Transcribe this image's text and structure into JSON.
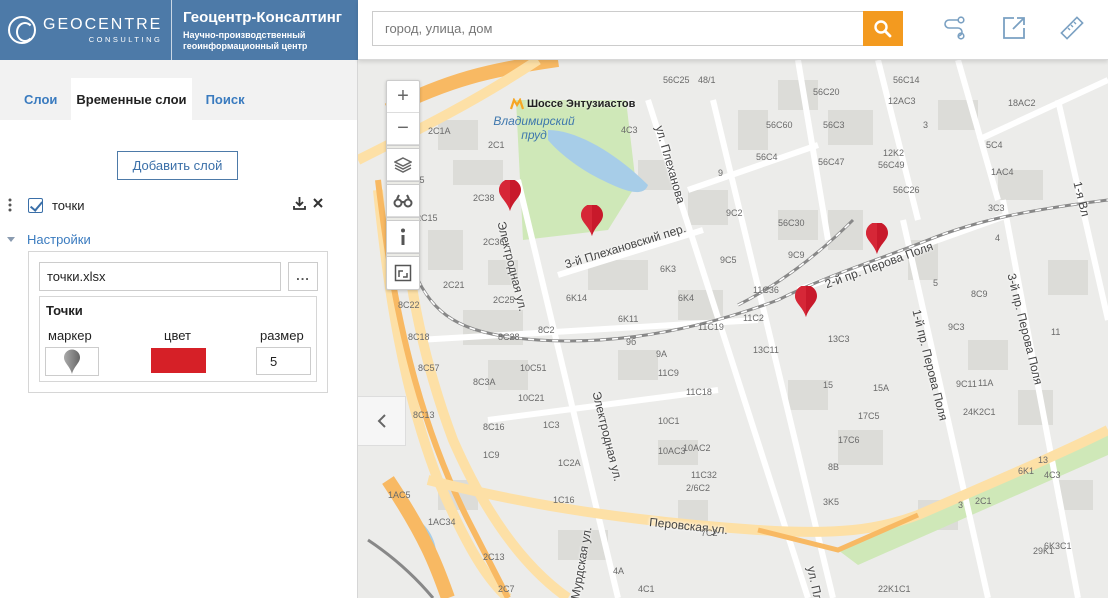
{
  "brand": {
    "logo_main": "GEOCENTRE",
    "logo_sub": "CONSULTING",
    "name": "Геоцентр-Консалтинг",
    "desc_line1": "Научно-производственный",
    "desc_line2": "геоинформационный центр",
    "bg_color": "#4d7aa8"
  },
  "search": {
    "placeholder": "город, улица, дом",
    "button_icon": "search-icon",
    "accent": "#f39a1f"
  },
  "toolbar": {
    "icons": [
      "route-icon",
      "external-link-icon",
      "ruler-icon"
    ]
  },
  "sidebar": {
    "tabs": [
      {
        "label": "Слои"
      },
      {
        "label": "Временные слои",
        "active": true
      },
      {
        "label": "Поиск"
      }
    ],
    "add_layer_label": "Добавить слой",
    "layer": {
      "name": "точки",
      "checked": true
    },
    "settings_label": "Настройки",
    "file_value": "точки.xlsx",
    "browse_label": "...",
    "style_title": "Точки",
    "marker_label": "маркер",
    "color_label": "цвет",
    "size_label": "размер",
    "color_value": "#d62027",
    "size_value": "5"
  },
  "map": {
    "metro": "Шоссе Энтузиастов",
    "pond": "Владимирский пруд",
    "streets": [
      "Электродная ул.",
      "Электродная ул.",
      "3-й Плехановский пер.",
      "ул. Плеханова",
      "2-й пр. Перова Поля",
      "1-й пр. Перова Поля",
      "3-й пр. Перова Поля",
      "Перовская ул.",
      "Мурдская ул.",
      "ул. Пл",
      "1-я Вл"
    ],
    "houses": [
      "2C1A",
      "2C1",
      "2C5",
      "2C38",
      "2C15",
      "2C36",
      "2C21",
      "2C25",
      "8C22",
      "8C18",
      "8C28",
      "8C2",
      "8C57",
      "8C3A",
      "10C51",
      "8C13",
      "10C21",
      "8C16",
      "1C3",
      "1C9",
      "1C2A",
      "1AC5",
      "1C16",
      "1AC34",
      "2C13",
      "2C7",
      "4A",
      "4C3",
      "4C1",
      "6K3",
      "6K14",
      "6K4",
      "6K11",
      "9б",
      "9A",
      "11C19",
      "11C9",
      "11C18",
      "10C1",
      "10AC3",
      "10AC2",
      "11C32",
      "2/6C2",
      "7C2",
      "9",
      "9C2",
      "9C5",
      "9C9",
      "11C36",
      "11C2",
      "13C3",
      "13C11",
      "15",
      "15A",
      "17C5",
      "17C6",
      "8B",
      "3K5",
      "48/1",
      "56C25",
      "56C14",
      "56C20",
      "56C60",
      "56C3",
      "56C4",
      "56C47",
      "56C30",
      "56C26",
      "56C49",
      "3",
      "12K2",
      "12AC3",
      "18AC2",
      "5C4",
      "1AC4",
      "3C3",
      "4",
      "5",
      "8C9",
      "9C3",
      "9C11",
      "11A",
      "24K2C1",
      "11",
      "13",
      "6K1",
      "4C3",
      "2C1",
      "3",
      "6K3C1",
      "29K1",
      "22K1C1"
    ],
    "zoom_in": "+",
    "zoom_out": "−",
    "pin_color": "#c8192b",
    "points_count": 4
  }
}
